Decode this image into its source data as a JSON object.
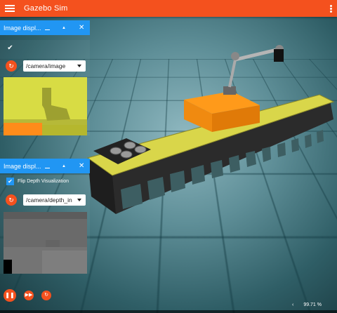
{
  "app": {
    "title": "Gazebo Sim"
  },
  "panels": [
    {
      "title": "Image displ...",
      "checkbox_label": "",
      "topic": "/camera/image"
    },
    {
      "title": "Image displ...",
      "checkbox_label": "Flip Depth Visualization",
      "topic": "/camera/depth_in"
    }
  ],
  "status": {
    "rtf": "99.71 %"
  },
  "colors": {
    "appbar": "#f4511e",
    "panel_header": "#2196f3",
    "accent": "#f4511e"
  },
  "icons": [
    "menu-icon",
    "kebab-menu-icon",
    "minimize-icon",
    "maximize-icon",
    "close-icon",
    "check-icon",
    "refresh-icon",
    "play-pause-icon",
    "step-icon",
    "reset-icon",
    "chevron-left-icon"
  ]
}
